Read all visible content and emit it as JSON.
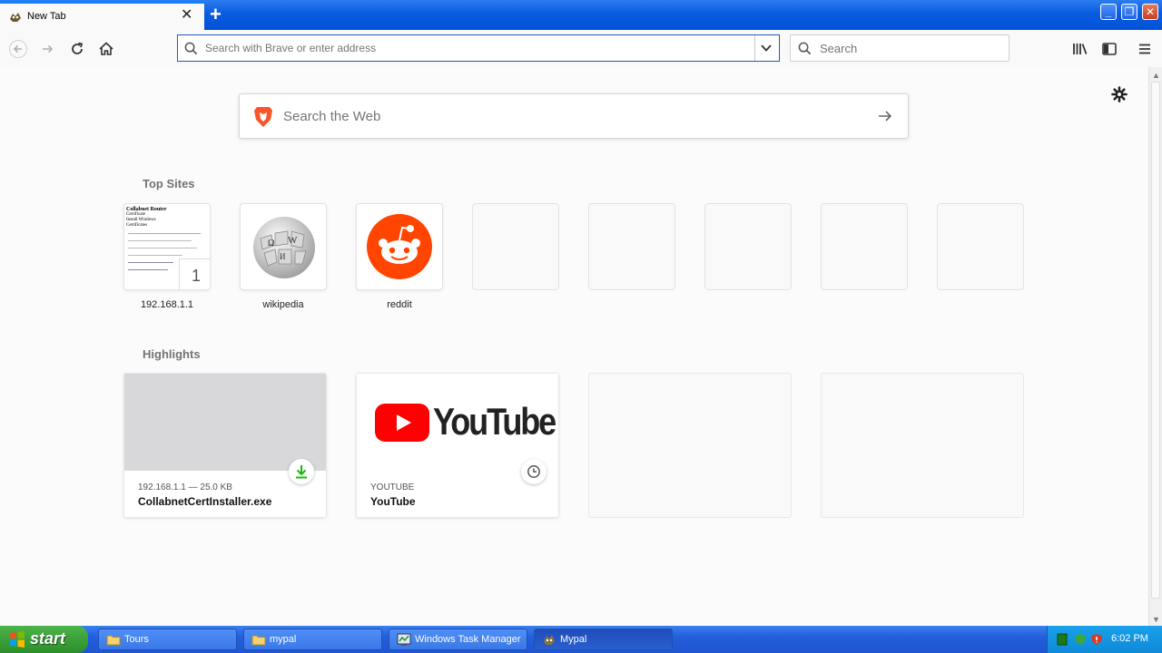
{
  "window": {
    "tab_title": "New Tab",
    "minimize_glyph": "_",
    "restore_glyph": "❐",
    "close_glyph": "✕"
  },
  "toolbar": {
    "url_placeholder": "Search with Brave or enter address",
    "search_placeholder": "Search"
  },
  "newtab": {
    "web_search_placeholder": "Search the Web",
    "top_sites_title": "Top Sites",
    "top_sites": [
      {
        "label": "192.168.1.1",
        "kind": "screenshot",
        "badge": "1"
      },
      {
        "label": "wikipedia",
        "kind": "wikipedia-icon"
      },
      {
        "label": "reddit",
        "kind": "reddit-icon"
      },
      {
        "label": "",
        "kind": "empty"
      },
      {
        "label": "",
        "kind": "empty"
      },
      {
        "label": "",
        "kind": "empty"
      },
      {
        "label": "",
        "kind": "empty"
      },
      {
        "label": "",
        "kind": "empty"
      }
    ],
    "highlights_title": "Highlights",
    "highlights": [
      {
        "context": "192.168.1.1 — 25.0 KB",
        "title": "CollabnetCertInstaller.exe",
        "badge": "download-icon"
      },
      {
        "context": "YOUTUBE",
        "title": "YouTube",
        "badge": "clock-icon",
        "logo_text": "YouTube"
      }
    ],
    "screenshot_text": {
      "heading": "Collabnet Router",
      "lines": [
        "Certificate",
        "Install Windows",
        "Certificates"
      ]
    }
  },
  "taskbar": {
    "start_label": "start",
    "tasks": [
      {
        "label": "Tours",
        "icon": "folder-icon"
      },
      {
        "label": "mypal",
        "icon": "folder-icon"
      },
      {
        "label": "Windows Task Manager",
        "icon": "task-manager-icon"
      },
      {
        "label": "Mypal",
        "icon": "mypal-icon"
      }
    ],
    "clock": "6:02 PM"
  },
  "colors": {
    "accent": "#0a84ff",
    "reddit": "#ff4500",
    "youtube": "#ff0000",
    "download_green": "#12bc00"
  }
}
